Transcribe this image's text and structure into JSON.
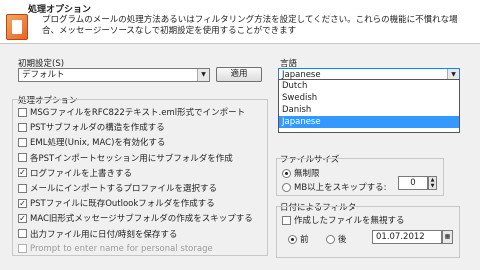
{
  "header": {
    "title": "処理オプション",
    "description": "プログラムのメールの処理方法あるいはフィルタリング方法を設定してください。これらの機能に不慣れな場合、メッセージーソースなしで初期設定を使用することができます"
  },
  "presets": {
    "label": "初期設定(S)",
    "value": "デフォルト",
    "apply_label": "適用"
  },
  "options": {
    "label": "処理オプション",
    "items": [
      {
        "label": "MSGファイルをRFC822テキスト.eml形式でインポート",
        "checked": false,
        "enabled": true
      },
      {
        "label": "PSTサブフォルダの構造を作成する",
        "checked": false,
        "enabled": true
      },
      {
        "label": "EML処理(Unix, MAC)を有効化する",
        "checked": false,
        "enabled": true
      },
      {
        "label": "各PSTインポートセッション用にサブフォルダを作成",
        "checked": false,
        "enabled": true
      },
      {
        "label": "ログファイルを上書きする",
        "checked": true,
        "enabled": true
      },
      {
        "label": "メールにインポートするプロファイルを選択する",
        "checked": false,
        "enabled": true
      },
      {
        "label": "PSTファイルに既存Outlookフォルダを作成する",
        "checked": true,
        "enabled": true
      },
      {
        "label": "MAC旧形式メッセージサブフォルダの作成をスキップする",
        "checked": true,
        "enabled": true
      },
      {
        "label": "出力ファイル用に日付/時刻を保存する",
        "checked": false,
        "enabled": true
      },
      {
        "label": "Prompt to enter name for personal storage",
        "checked": false,
        "enabled": false
      }
    ]
  },
  "language": {
    "label": "言語",
    "selected": "Japanese",
    "options": [
      "Dutch",
      "Swedish",
      "Danish",
      "Japanese"
    ]
  },
  "filesize": {
    "label": "ファイルサイズ",
    "unlimited_label": "無制限",
    "skip_label": "MB以上をスキップする:",
    "skip_value": "0"
  },
  "date_filter": {
    "label": "日付によるフィルタ",
    "checkbox_label": "作成したファイルを無視する",
    "before_label": "前",
    "after_label": "後",
    "date_value": "01.07.2012"
  }
}
